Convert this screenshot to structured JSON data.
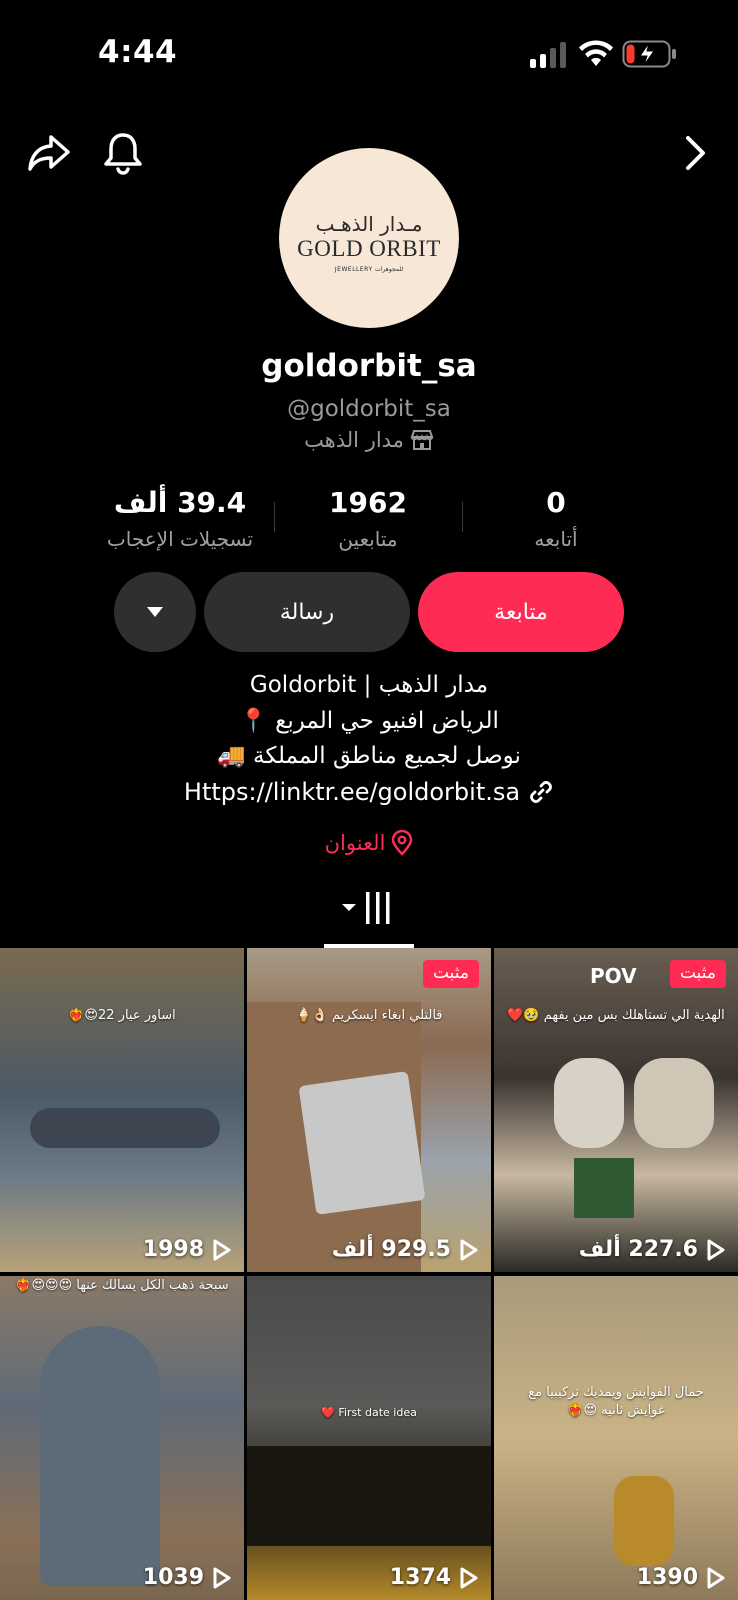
{
  "status_bar": {
    "time": "4:44",
    "icons": [
      "signal-icon",
      "wifi-icon",
      "battery-charging-icon"
    ]
  },
  "nav": {
    "icons": [
      "share-icon",
      "bell-icon",
      "chevron-right-icon"
    ]
  },
  "profile": {
    "avatar_logo_ar": "مـدار الذهـب",
    "avatar_logo_en": "GOLD ORBIT",
    "avatar_logo_sub": "JEWELLERY  للمجوهرات",
    "display_name": "goldorbit_sa",
    "handle": "@goldorbit_sa",
    "category": "مدار الذهب",
    "category_icon": "shop-icon"
  },
  "stats": {
    "following": {
      "value": "0",
      "label": "أتابعه"
    },
    "followers": {
      "value": "1962",
      "label": "متابعين"
    },
    "likes": {
      "value": "39.4 ألف",
      "label": "تسجيلات الإعجاب"
    }
  },
  "actions": {
    "follow_label": "متابعة",
    "message_label": "رسالة",
    "more_icon": "caret-down-icon"
  },
  "bio": {
    "line1": "مدار الذهب | Goldorbit",
    "line2": "الرياض افنيو حي المربع 📍",
    "line3": "نوصل لجميع مناطق المملكة 🚚",
    "link": "Https://linktr.ee/goldorbit.sa",
    "link_icon": "link-icon",
    "address": "العنوان",
    "address_icon": "location-pin-icon"
  },
  "tabs": {
    "active_icon": "grid-icon"
  },
  "colors": {
    "accent": "#fe2c55",
    "background": "#000000",
    "button_dark": "#2f2f2f",
    "secondary_text": "#9a9a9a"
  },
  "videos": [
    {
      "caption": "اساور عيار 22😍❤️‍🔥",
      "pinned": false,
      "views": "1998"
    },
    {
      "caption": "قالتلي ابغاء ايسكريم 👌🏻🍦",
      "pinned": true,
      "pinned_label": "مثبت",
      "views": "929.5 ألف"
    },
    {
      "caption": "الهدية الي تستاهلك بس مين يفهم 🥹❤️",
      "pinned": true,
      "pinned_label": "مثبت",
      "overlay": "POV",
      "views": "227.6 ألف"
    },
    {
      "caption": "سبحة ذهب الكل يسالك عنها 😍😍😍❤️‍🔥",
      "pinned": false,
      "views": "1039"
    },
    {
      "caption": "First date idea ❤️",
      "pinned": false,
      "views": "1374"
    },
    {
      "caption": "جمال الفوايش ويمديك تركيبيا مع غوايش ثانيه 😍❤️‍🔥",
      "pinned": false,
      "views": "1390"
    }
  ]
}
